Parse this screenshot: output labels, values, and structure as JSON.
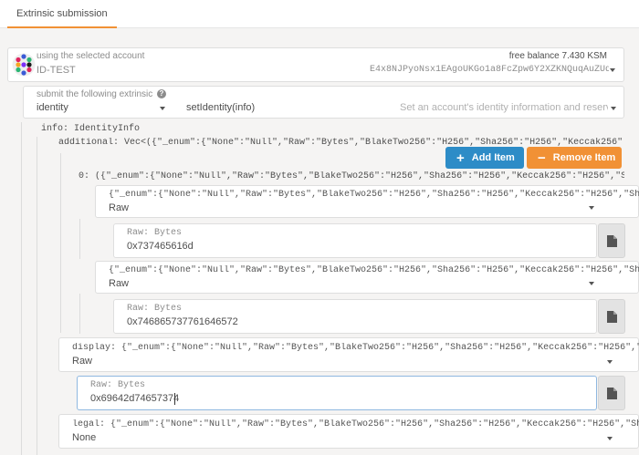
{
  "tabs": [
    {
      "label": "Extrinsic submission"
    }
  ],
  "account": {
    "label": "using the selected account",
    "name": "ID-TEST",
    "balance": "free balance 7.430 KSM",
    "address": "E4x8NJPyoNsx1EAgoUKGo1a8FcZpw6Y2XZKNQuqAuZUqjjA"
  },
  "extrinsic": {
    "label": "submit the following extrinsic",
    "module": "identity",
    "method": "setIdentity(info)",
    "description": "Set an account's identity information and reserv..."
  },
  "params": {
    "info_label": "info: IdentityInfo",
    "additional_label": "additional: Vec<({\"_enum\":{\"None\":\"Null\",\"Raw\":\"Bytes\",\"BlakeTwo256\":\"H256\",\"Sha256\":\"H256\",\"Keccak256\":\"H256\",\"...",
    "add_item": "Add Item",
    "remove_item": "Remove Item",
    "tuple_label": "0: ({\"_enum\":{\"None\":\"Null\",\"Raw\":\"Bytes\",\"BlakeTwo256\":\"H256\",\"Sha256\":\"H256\",\"Keccak256\":\"H256\",\"ShaThree2...",
    "enum_label": "{\"_enum\":{\"None\":\"Null\",\"Raw\":\"Bytes\",\"BlakeTwo256\":\"H256\",\"Sha256\":\"H256\",\"Keccak256\":\"H256\",\"ShaThree256\":\"H256\"",
    "field1_value": "Raw",
    "raw_label": "Raw: Bytes",
    "field1_bytes": "0x737465616d",
    "field2_value": "Raw",
    "field2_bytes": "0x746865737761646572",
    "display_label": "display: {\"_enum\":{\"None\":\"Null\",\"Raw\":\"Bytes\",\"BlakeTwo256\":\"H256\",\"Sha256\":\"H256\",\"Keccak256\":\"H256\",\"ShaThree25",
    "display_value": "Raw",
    "display_bytes": "0x69642d74657374",
    "legal_label": "legal: {\"_enum\":{\"None\":\"Null\",\"Raw\":\"Bytes\",\"BlakeTwo256\":\"H256\",\"Sha256\":\"H256\",\"Keccak256\":\"H256\",\"ShaThree25",
    "legal_value": "None"
  },
  "colors": {
    "accent": "#f19135",
    "primary": "#2d8cc7"
  }
}
